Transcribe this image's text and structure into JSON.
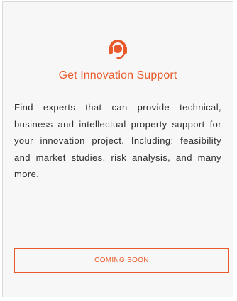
{
  "card": {
    "icon": "headset-icon",
    "title": "Get Innovation Support",
    "description": "Find experts that can provide technical, business and intellectual property support for your innovation project. Including: feasibility and market studies, risk analysis, and many more.",
    "button_label": "COMING SOON"
  },
  "colors": {
    "accent": "#e85a2b",
    "text": "#2b2b2b",
    "card_background": "#f7f7f7",
    "border": "#d9d9d9"
  }
}
